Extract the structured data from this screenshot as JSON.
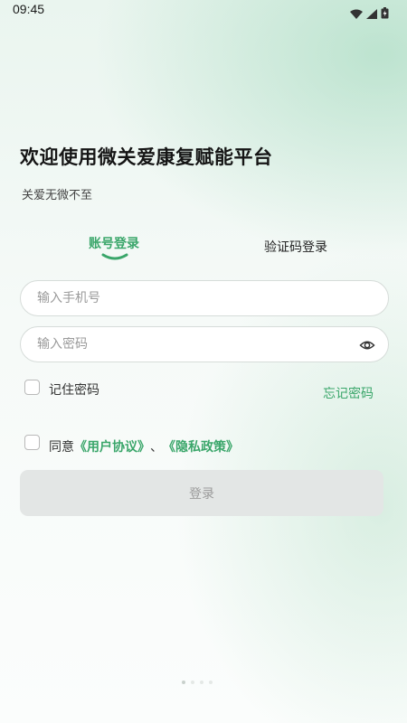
{
  "status_bar": {
    "time": "09:45",
    "icons": [
      "wifi-icon",
      "signal-icon",
      "battery-icon"
    ]
  },
  "header": {
    "title": "欢迎使用微关爱康复赋能平台",
    "subtitle": "关爱无微不至"
  },
  "tabs": [
    {
      "label": "账号登录",
      "active": true
    },
    {
      "label": "验证码登录",
      "active": false
    }
  ],
  "form": {
    "phone_placeholder": "输入手机号",
    "phone_value": "",
    "password_placeholder": "输入密码",
    "password_value": "",
    "remember_label": "记住密码",
    "remember_checked": false,
    "forgot_label": "忘记密码",
    "agreement": {
      "prefix": "同意",
      "user_agreement": "《用户协议》",
      "separator": "、",
      "privacy_policy": "《隐私政策》",
      "checked": false
    },
    "login_label": "登录"
  },
  "pager": {
    "count": 4,
    "active_index": 0
  },
  "colors": {
    "accent": "#3aa66a",
    "button_disabled_bg": "#e3e6e5",
    "button_disabled_text": "#9b9b9b"
  }
}
